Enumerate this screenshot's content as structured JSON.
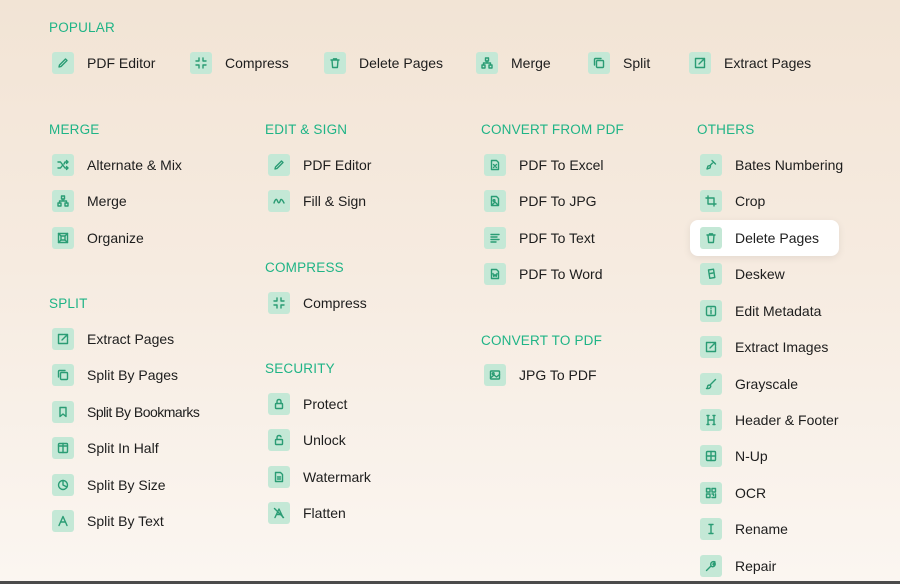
{
  "popular": {
    "title": "POPULAR",
    "items": [
      {
        "label": "PDF Editor",
        "icon": "pencil-icon"
      },
      {
        "label": "Compress",
        "icon": "compress-icon"
      },
      {
        "label": "Delete Pages",
        "icon": "trash-icon"
      },
      {
        "label": "Merge",
        "icon": "merge-icon"
      },
      {
        "label": "Split",
        "icon": "split-icon"
      },
      {
        "label": "Extract Pages",
        "icon": "extract-icon"
      }
    ]
  },
  "merge": {
    "title": "MERGE",
    "items": [
      {
        "label": "Alternate & Mix",
        "icon": "shuffle-icon"
      },
      {
        "label": "Merge",
        "icon": "merge-icon"
      },
      {
        "label": "Organize",
        "icon": "organize-icon"
      }
    ]
  },
  "split": {
    "title": "SPLIT",
    "items": [
      {
        "label": "Extract Pages",
        "icon": "extract-icon"
      },
      {
        "label": "Split By Pages",
        "icon": "pages-icon"
      },
      {
        "label": "Split By Bookmarks",
        "icon": "bookmark-icon"
      },
      {
        "label": "Split In Half",
        "icon": "half-icon"
      },
      {
        "label": "Split By Size",
        "icon": "size-icon"
      },
      {
        "label": "Split By Text",
        "icon": "text-a-icon"
      }
    ]
  },
  "edit_sign": {
    "title": "EDIT & SIGN",
    "items": [
      {
        "label": "PDF Editor",
        "icon": "pencil-icon"
      },
      {
        "label": "Fill & Sign",
        "icon": "signature-icon"
      }
    ]
  },
  "compress": {
    "title": "COMPRESS",
    "items": [
      {
        "label": "Compress",
        "icon": "compress-icon"
      }
    ]
  },
  "security": {
    "title": "SECURITY",
    "items": [
      {
        "label": "Protect",
        "icon": "lock-icon"
      },
      {
        "label": "Unlock",
        "icon": "unlock-icon"
      },
      {
        "label": "Watermark",
        "icon": "watermark-icon"
      },
      {
        "label": "Flatten",
        "icon": "flatten-icon"
      }
    ]
  },
  "convert_from": {
    "title": "CONVERT FROM PDF",
    "items": [
      {
        "label": "PDF To Excel",
        "icon": "excel-icon"
      },
      {
        "label": "PDF To JPG",
        "icon": "jpg-icon"
      },
      {
        "label": "PDF To Text",
        "icon": "text-lines-icon"
      },
      {
        "label": "PDF To Word",
        "icon": "word-icon"
      }
    ]
  },
  "convert_to": {
    "title": "CONVERT TO PDF",
    "items": [
      {
        "label": "JPG To PDF",
        "icon": "image-icon"
      }
    ]
  },
  "others": {
    "title": "OTHERS",
    "items": [
      {
        "label": "Bates Numbering",
        "icon": "stamp-icon"
      },
      {
        "label": "Crop",
        "icon": "crop-icon"
      },
      {
        "label": "Delete Pages",
        "icon": "trash-icon"
      },
      {
        "label": "Deskew",
        "icon": "deskew-icon"
      },
      {
        "label": "Edit Metadata",
        "icon": "info-icon"
      },
      {
        "label": "Extract Images",
        "icon": "extract-icon"
      },
      {
        "label": "Grayscale",
        "icon": "brush-icon"
      },
      {
        "label": "Header & Footer",
        "icon": "header-icon"
      },
      {
        "label": "N-Up",
        "icon": "grid-icon"
      },
      {
        "label": "OCR",
        "icon": "qr-icon"
      },
      {
        "label": "Rename",
        "icon": "cursor-text-icon"
      },
      {
        "label": "Repair",
        "icon": "wrench-icon"
      }
    ]
  },
  "colors": {
    "accent": "#1fb486",
    "icon_bg": "#c4e8d6",
    "icon_stroke": "#2a9c74"
  }
}
